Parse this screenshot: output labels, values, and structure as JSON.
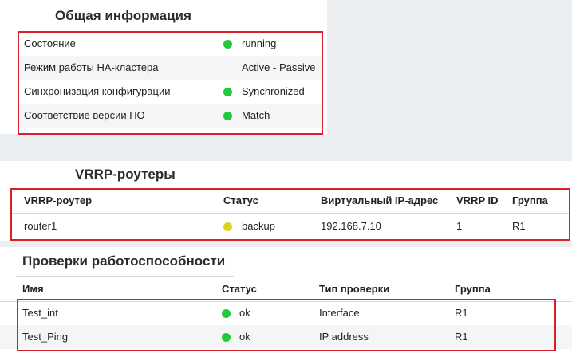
{
  "general": {
    "title": "Общая информация",
    "rows": [
      {
        "label": "Состояние",
        "value": "running",
        "status": "green"
      },
      {
        "label": "Режим работы HA-кластера",
        "value": "Active - Passive",
        "status": ""
      },
      {
        "label": "Синхронизация конфигурации",
        "value": "Synchronized",
        "status": "green"
      },
      {
        "label": "Соответствие версии ПО",
        "value": "Match",
        "status": "green"
      }
    ]
  },
  "vrrp": {
    "title": "VRRP-роутеры",
    "headers": [
      "VRRP-роутер",
      "Статус",
      "Виртуальный IP-адрес",
      "VRRP ID",
      "Группа"
    ],
    "rows": [
      {
        "router": "router1",
        "status": "backup",
        "status_color": "yellow",
        "ip": "192.168.7.10",
        "id": "1",
        "group": "R1"
      }
    ]
  },
  "health": {
    "title": "Проверки работоспособности",
    "headers": [
      "Имя",
      "Статус",
      "Тип проверки",
      "Группа"
    ],
    "rows": [
      {
        "name": "Test_int",
        "status": "ok",
        "status_color": "green",
        "type": "Interface",
        "group": "R1"
      },
      {
        "name": "Test_Ping",
        "status": "ok",
        "status_color": "green",
        "type": "IP address",
        "group": "R1"
      }
    ]
  },
  "colors": {
    "green": "#22c93c",
    "yellow": "#d9d41a",
    "highlight": "#d9202a"
  }
}
